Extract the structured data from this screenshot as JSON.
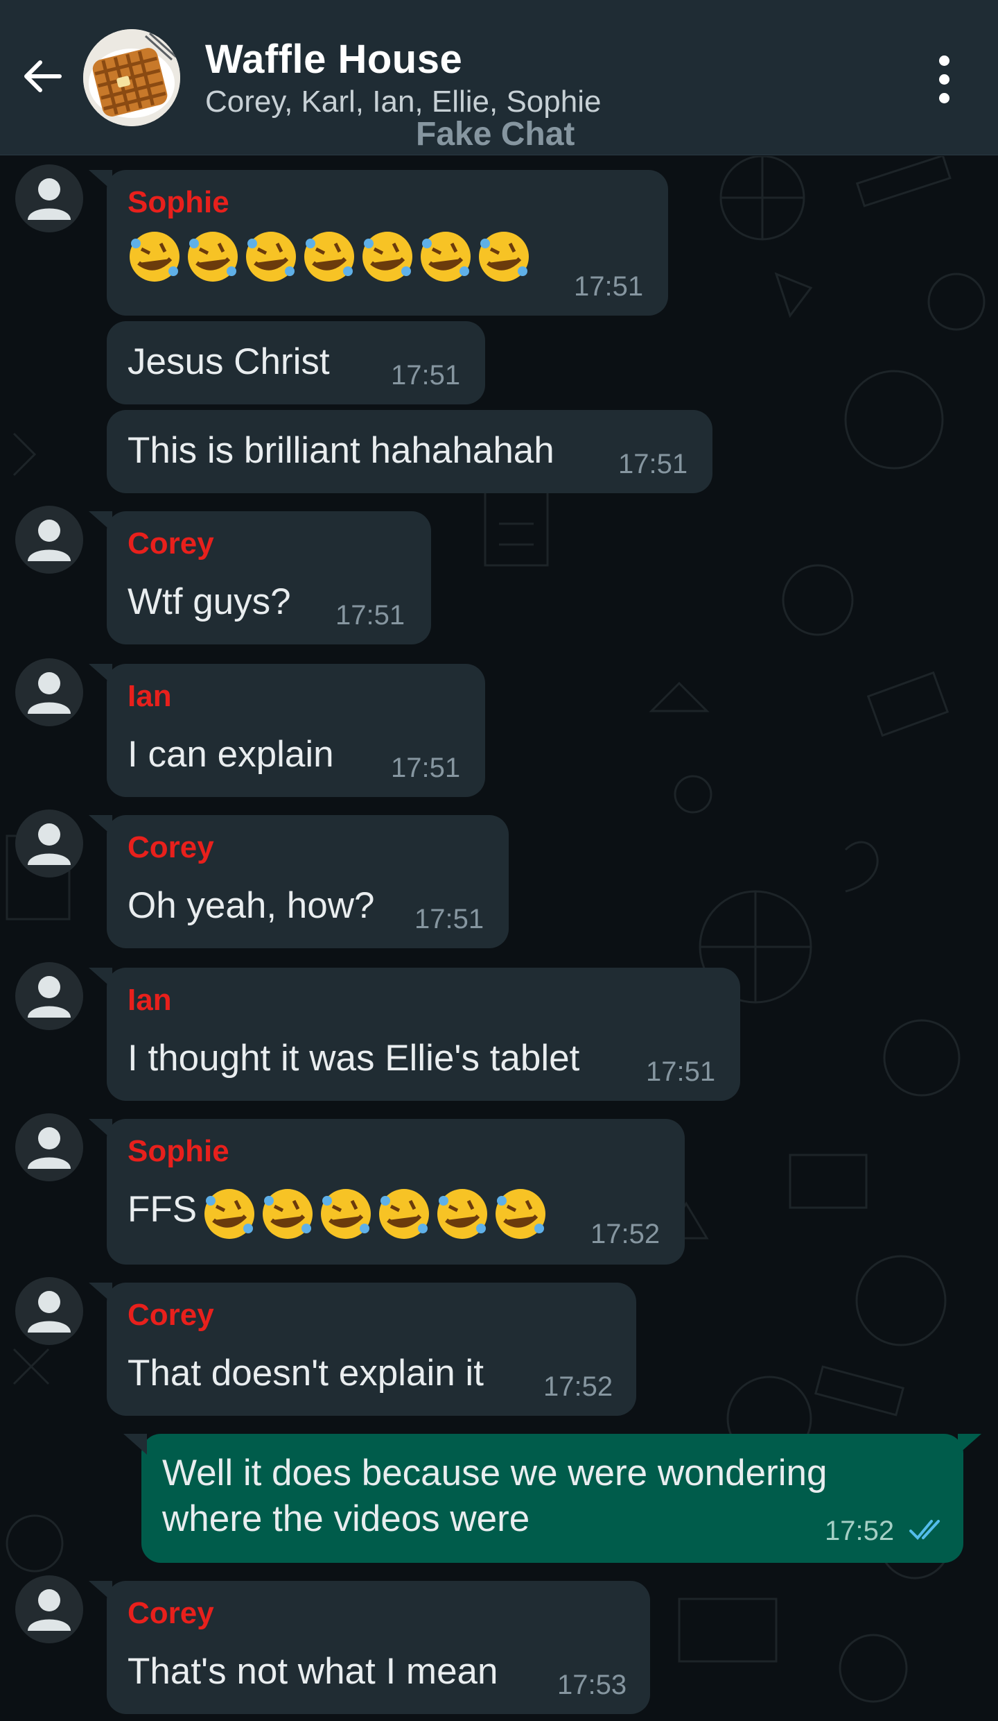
{
  "header": {
    "title": "Waffle House",
    "participants": "Corey, Karl, Ian, Ellie, Sophie",
    "watermark": "Fake Chat",
    "back_icon": "arrow-left-icon",
    "menu_icon": "more-vertical-icon"
  },
  "colors": {
    "header_bg": "#1f2c34",
    "chat_bg": "#0b1014",
    "incoming_bubble": "#202c33",
    "outgoing_bubble": "#005c4b",
    "sender_name": "#e8201c",
    "read_ticks": "#53bdeb"
  },
  "messages": [
    {
      "sender": "Sophie",
      "text": "",
      "emoji": "rolling-on-floor-laughing",
      "emoji_count": 7,
      "time": "17:51"
    },
    {
      "sender": "",
      "text": "Jesus Christ",
      "time": "17:51"
    },
    {
      "sender": "",
      "text": "This is brilliant hahahahah",
      "time": "17:51"
    },
    {
      "sender": "Corey",
      "text": "Wtf guys?",
      "time": "17:51"
    },
    {
      "sender": "Ian",
      "text": "I can explain",
      "time": "17:51"
    },
    {
      "sender": "Corey",
      "text": "Oh yeah, how?",
      "time": "17:51"
    },
    {
      "sender": "Ian",
      "text": "I thought it was Ellie's tablet",
      "time": "17:51"
    },
    {
      "sender": "Sophie",
      "text": "FFS",
      "emoji": "rolling-on-floor-laughing",
      "emoji_count": 6,
      "time": "17:52"
    },
    {
      "sender": "Corey",
      "text": "That doesn't explain it",
      "time": "17:52"
    },
    {
      "sender": "me",
      "text_line1": "Well it does because we were wondering",
      "text_line2": "where the videos were",
      "time": "17:52",
      "status": "read-double-check-icon"
    },
    {
      "sender": "Corey",
      "text": "That's not what I mean",
      "time": "17:53"
    }
  ]
}
